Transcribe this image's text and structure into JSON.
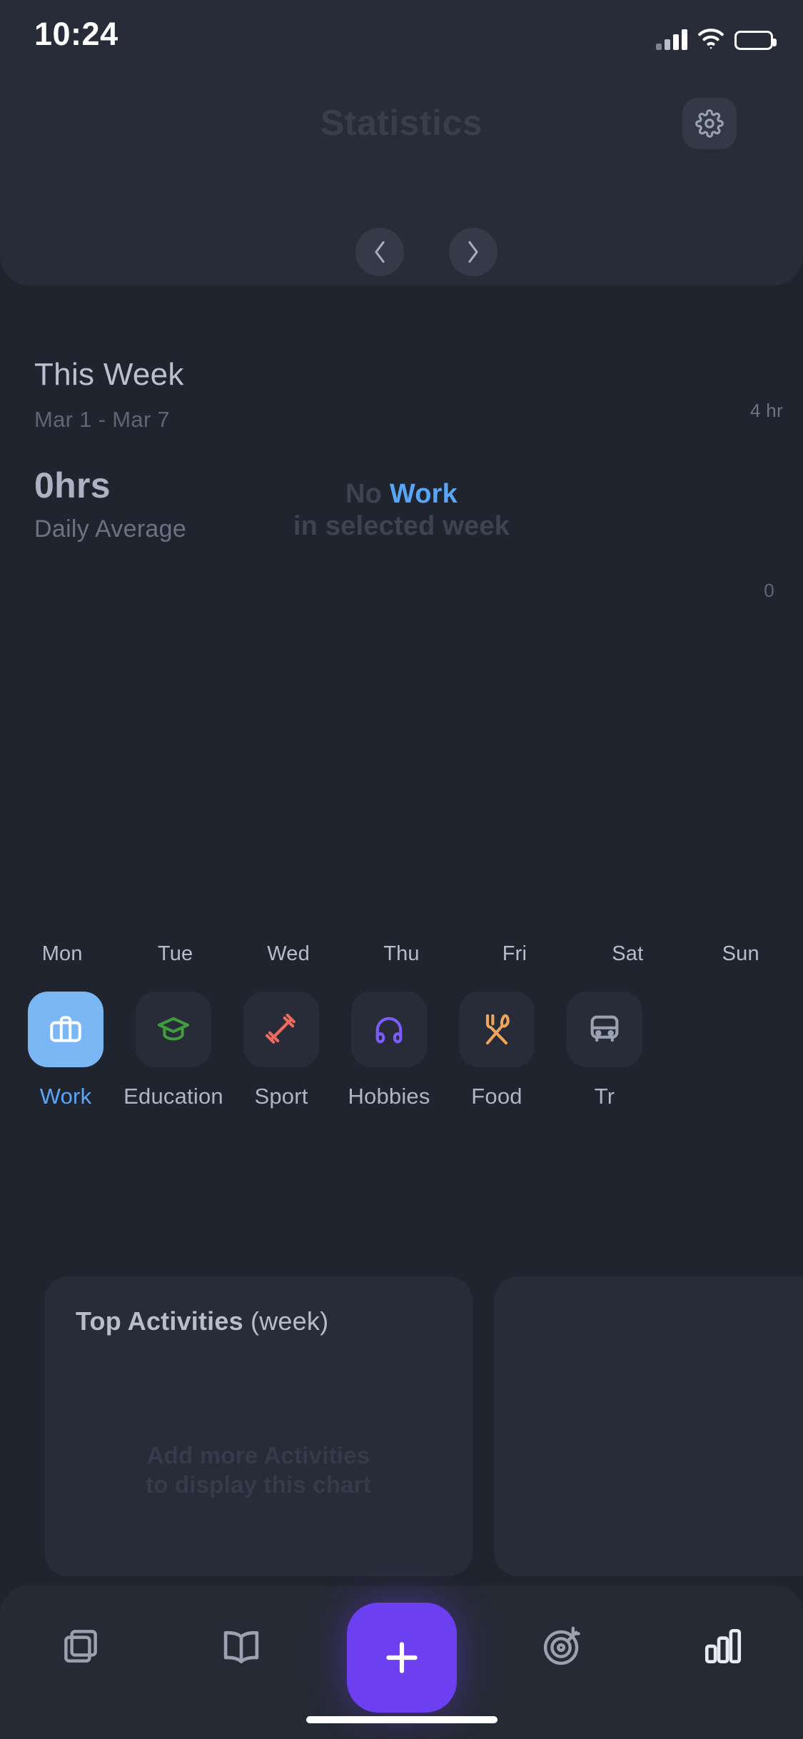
{
  "status_bar": {
    "time": "10:24",
    "cellular_icon": "cellular-bars-icon",
    "wifi_icon": "wifi-icon",
    "battery_icon": "battery-icon"
  },
  "header": {
    "title": "Statistics",
    "settings_icon": "gear-icon"
  },
  "week": {
    "title": "This Week",
    "range": "Mar 1 - Mar 7",
    "total": "0hrs",
    "subtitle": "Daily Average",
    "prev_icon": "chevron-left-icon",
    "next_icon": "chevron-right-icon"
  },
  "chart_data": {
    "type": "bar",
    "title": "",
    "categories": [
      "Mon",
      "Tue",
      "Wed",
      "Thu",
      "Fri",
      "Sat",
      "Sun"
    ],
    "values": [
      0,
      0,
      0,
      0,
      0,
      0,
      0
    ],
    "series": [
      {
        "name": "Work",
        "values": [
          0,
          0,
          0,
          0,
          0,
          0,
          0
        ]
      }
    ],
    "ylabel": "",
    "xlabel": "",
    "ylim": [
      0,
      4
    ],
    "y_tick_labels": [
      "4 hr",
      "0"
    ],
    "grid": false,
    "legend": "none",
    "empty_state": {
      "prefix": "No ",
      "highlight": "Work",
      "line2": "in selected week",
      "highlight_color": "#59a6f8"
    }
  },
  "categories": {
    "items": [
      {
        "label": "Work",
        "icon": "briefcase-icon",
        "color": "#ffffff",
        "tile_color": "#7bb6f5",
        "active": true
      },
      {
        "label": "Education",
        "icon": "graduation-cap-icon",
        "color": "#3f9c3f",
        "tile_color": "#282c38",
        "active": false
      },
      {
        "label": "Sport",
        "icon": "dumbbell-icon",
        "color": "#ef6a5c",
        "tile_color": "#282c38",
        "active": false
      },
      {
        "label": "Hobbies",
        "icon": "headphones-icon",
        "color": "#7c5cfa",
        "tile_color": "#282c38",
        "active": false
      },
      {
        "label": "Food",
        "icon": "fork-spoon-icon",
        "color": "#efa45b",
        "tile_color": "#282c38",
        "active": false
      },
      {
        "label": "Tr",
        "icon": "transport-icon",
        "color": "#9aa2b2",
        "tile_color": "#282c38",
        "active": false
      }
    ]
  },
  "top_activities_card": {
    "title_bold": "Top Activities",
    "title_light": " (week)",
    "empty_line1": "Add more Activities",
    "empty_line2": "to display this chart"
  },
  "tab_bar": {
    "items": [
      {
        "name": "cards-icon"
      },
      {
        "name": "book-icon"
      },
      {
        "name": "add-icon"
      },
      {
        "name": "target-icon"
      },
      {
        "name": "statistics-icon"
      }
    ],
    "accent_color": "#6c3ff0"
  }
}
